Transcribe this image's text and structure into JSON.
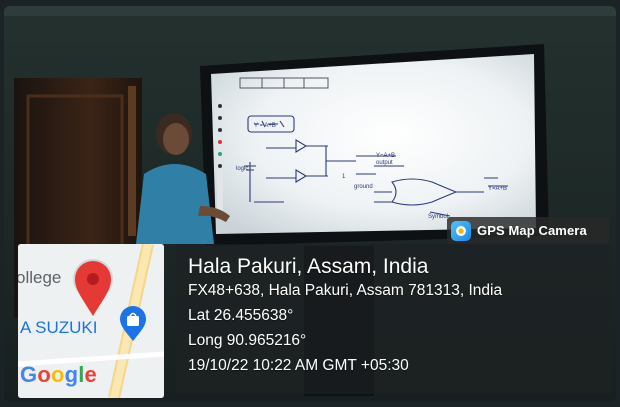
{
  "camera_badge": {
    "label": "GPS Map Camera",
    "icon": "camera-pin-icon"
  },
  "location": {
    "title": "Hala Pakuri, Assam, India",
    "address": "FX48+638, Hala Pakuri, Assam 781313, India",
    "latitude": "Lat 26.455638°",
    "longitude": "Long 90.965216°",
    "datetime": "19/10/22 10:22 AM GMT +05:30"
  },
  "map": {
    "place_label_1": "ollege",
    "place_label_2": "A SUZUKI",
    "logo": "Google",
    "pin_icon": "map-pin-icon",
    "shopping_icon": "shopping-bag-pin-icon",
    "logo_colors": [
      "#4285f4",
      "#ea4335",
      "#fbbc05",
      "#4285f4",
      "#34a853",
      "#ea4335"
    ]
  },
  "whiteboard": {
    "equation": "Y = A+B",
    "labels": [
      "Y=A+B",
      "output",
      "Y=A+B",
      "ground",
      "Symbol",
      "logic",
      "1"
    ]
  }
}
